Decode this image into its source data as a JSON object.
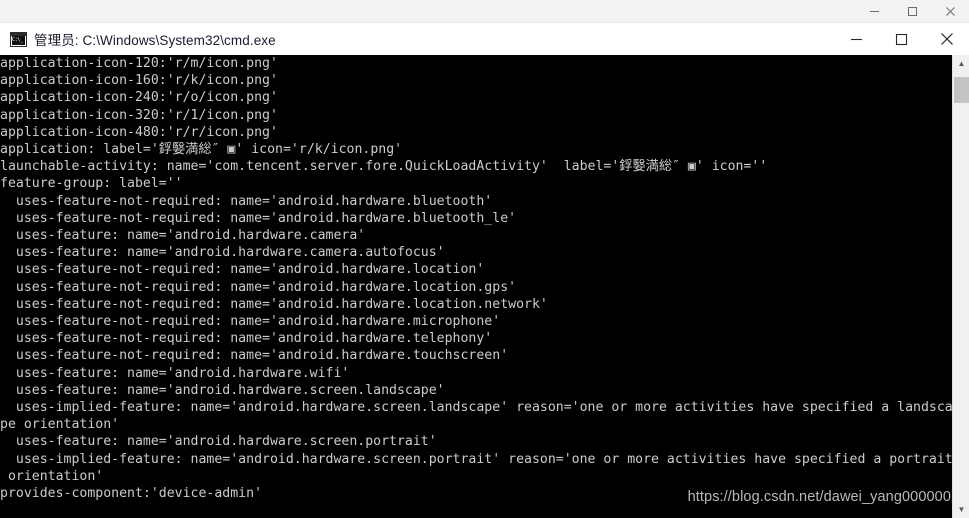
{
  "outer_window": {
    "minimize_label": "—",
    "maximize_label": "□",
    "close_label": "✕"
  },
  "inner_window": {
    "icon_name": "cmd-console-icon",
    "title": "管理员: C:\\Windows\\System32\\cmd.exe",
    "minimize_label": "—",
    "maximize_label": "□",
    "close_label": "✕"
  },
  "scrollbar": {
    "up_arrow": "▲",
    "down_arrow": "▼"
  },
  "console": {
    "background_color": "#000000",
    "text_color": "#cccccc",
    "output": "application-icon-120:'r/m/icon.png'\napplication-icon-160:'r/k/icon.png'\napplication-icon-240:'r/o/icon.png'\napplication-icon-320:'r/1/icon.png'\napplication-icon-480:'r/r/icon.png'\napplication: label='鋢嫛満総″ ▣' icon='r/k/icon.png'\nlaunchable-activity: name='com.tencent.server.fore.QuickLoadActivity'  label='鋢嫛満総″ ▣' icon=''\nfeature-group: label=''\n  uses-feature-not-required: name='android.hardware.bluetooth'\n  uses-feature-not-required: name='android.hardware.bluetooth_le'\n  uses-feature: name='android.hardware.camera'\n  uses-feature: name='android.hardware.camera.autofocus'\n  uses-feature-not-required: name='android.hardware.location'\n  uses-feature-not-required: name='android.hardware.location.gps'\n  uses-feature-not-required: name='android.hardware.location.network'\n  uses-feature-not-required: name='android.hardware.microphone'\n  uses-feature-not-required: name='android.hardware.telephony'\n  uses-feature-not-required: name='android.hardware.touchscreen'\n  uses-feature: name='android.hardware.wifi'\n  uses-feature: name='android.hardware.screen.landscape'\n  uses-implied-feature: name='android.hardware.screen.landscape' reason='one or more activities have specified a landsca\npe orientation'\n  uses-feature: name='android.hardware.screen.portrait'\n  uses-implied-feature: name='android.hardware.screen.portrait' reason='one or more activities have specified a portrait\n orientation'\nprovides-component:'device-admin'"
  },
  "watermark": {
    "text": "https://blog.csdn.net/dawei_yang000000"
  }
}
